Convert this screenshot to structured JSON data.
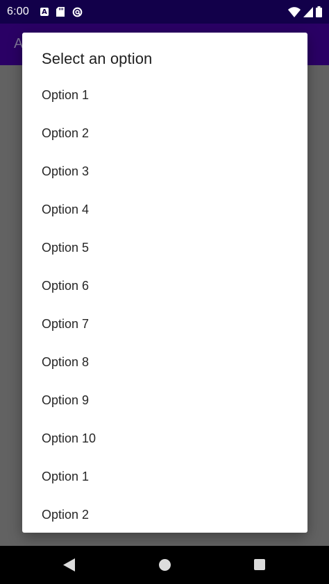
{
  "status_bar": {
    "time": "6:00",
    "left_icons": [
      "a-notification-icon",
      "sd-card-icon",
      "sync-circle-icon"
    ],
    "right_icons": [
      "wifi-icon",
      "signal-icon",
      "battery-icon"
    ]
  },
  "app_bar": {
    "title_fragment": "A"
  },
  "dialog": {
    "title": "Select an option",
    "options": [
      "Option 1",
      "Option 2",
      "Option 3",
      "Option 4",
      "Option 5",
      "Option 6",
      "Option 7",
      "Option 8",
      "Option 9",
      "Option 10",
      "Option 1",
      "Option 2"
    ]
  },
  "nav_bar": {
    "buttons": [
      "back-icon",
      "home-icon",
      "recents-icon"
    ]
  },
  "colors": {
    "status_bar": "#12004a",
    "app_bar": "#2e006e",
    "scrim": "#6b6b6b",
    "dialog_bg": "#ffffff",
    "nav_bar": "#000000"
  }
}
